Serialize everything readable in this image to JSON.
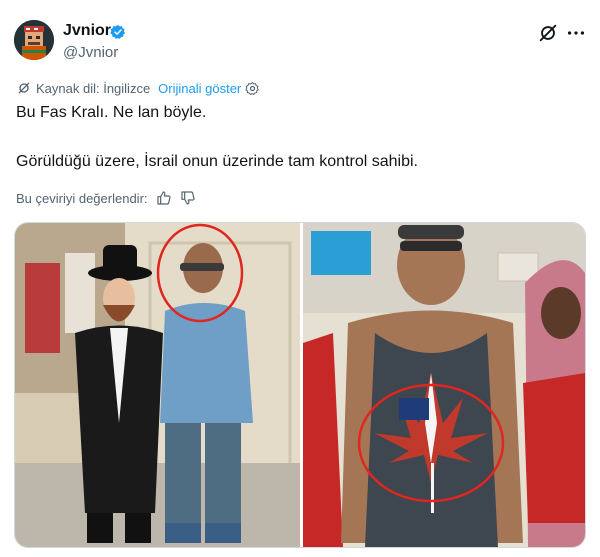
{
  "author": {
    "name": "Jvnior",
    "handle": "@Jvnior",
    "verified_icon": "verified-badge-icon"
  },
  "translation": {
    "source_language_label": "Kaynak dil: İngilizce",
    "show_original": "Orijinali göster"
  },
  "tweet": {
    "line1": "Bu Fas Kralı. Ne lan böyle.",
    "line2": "Görüldüğü üzere, İsrail onun üzerinde tam kontrol sahibi."
  },
  "rating": {
    "label": "Bu çeviriyi değerlendir:"
  },
  "icons": {
    "grok": "grok-icon",
    "more": "more-icon",
    "settings": "settings-gear-icon",
    "thumbs_up": "thumbs-up-icon",
    "thumbs_down": "thumbs-down-icon"
  },
  "colors": {
    "link": "#1d9bf0",
    "verified": "#1d9bf0",
    "secondary_text": "#536471",
    "annotation_circle": "#e0261f"
  }
}
